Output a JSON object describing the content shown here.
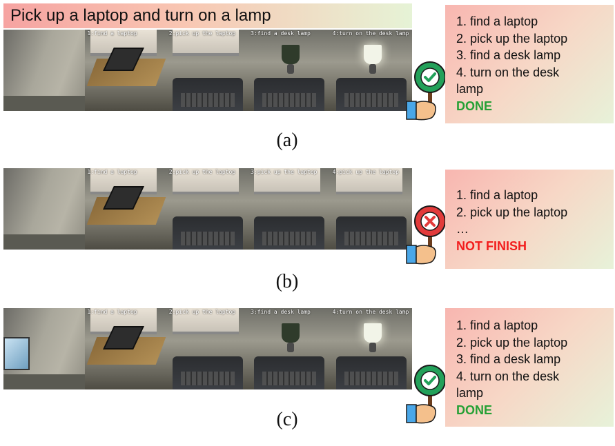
{
  "task": {
    "title": "Pick up a laptop and turn on a lamp"
  },
  "rows": [
    {
      "caption": "(a)",
      "frames": [
        "",
        "1:find a laptop",
        "2:pick up the laptop",
        "3:find a desk lamp",
        "4:turn on the desk lamp"
      ],
      "checklist": {
        "items": [
          "1. find a laptop",
          "2. pick up the laptop",
          "3. find a desk lamp",
          "4. turn on the desk",
          "lamp"
        ],
        "status": "DONE"
      },
      "verdict_icon": "check-icon"
    },
    {
      "caption": "(b)",
      "frames": [
        "",
        "1:find a laptop",
        "2:pick up the laptop",
        "3:pick up the laptop",
        "4:pick up the laptop"
      ],
      "checklist": {
        "items": [
          "1. find a laptop",
          "2. pick up the laptop",
          "…"
        ],
        "status": "NOT FINISH"
      },
      "verdict_icon": "cross-icon"
    },
    {
      "caption": "(c)",
      "frames": [
        "",
        "1:find a laptop",
        "2:pick up the laptop",
        "3:find a desk lamp",
        "4:turn on the desk lamp"
      ],
      "checklist": {
        "items": [
          "1. find a laptop",
          "2. pick up the laptop",
          "3. find a desk lamp",
          "4. turn on the desk",
          "lamp"
        ],
        "status": "DONE"
      },
      "verdict_icon": "check-icon"
    }
  ],
  "colors": {
    "done": "#25a035",
    "fail": "#f21d1d",
    "check_badge": "#23a15a",
    "cross_badge": "#e23b3b"
  }
}
